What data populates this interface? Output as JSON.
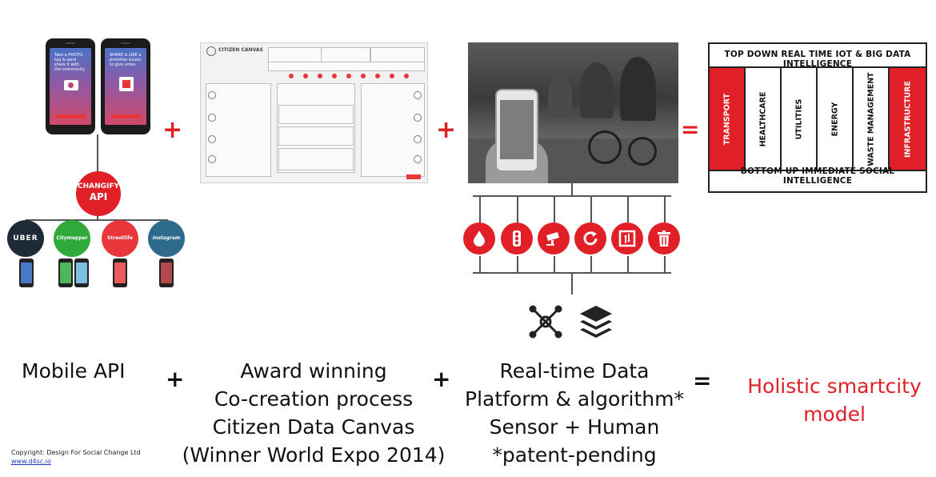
{
  "phones": {
    "left_text": "Take a PHOTO, tag & send share it with the community",
    "right_text": "SHARE & LIKE a prioritise issues to give votes"
  },
  "api": {
    "label_line1": "CHANGIFY",
    "label_line2": "API"
  },
  "brands": [
    "UBER",
    "Citymapper",
    "Streetlife",
    "Instagram"
  ],
  "canvas": {
    "title": "CITIZEN CANVAS"
  },
  "matrix": {
    "top": "TOP DOWN REAL TIME IOT & BIG DATA INTELLIGENCE",
    "bottom": "BOTTOM UP IMMEDIATE SOCIAL INTELLIGENCE",
    "columns": [
      "TRANSPORT",
      "HEALTHCARE",
      "UTILITIES",
      "ENERGY",
      "WASTE MANAGEMENT",
      "INFRASTRUCTURE"
    ]
  },
  "captions": {
    "mobile": "Mobile API",
    "cocreation": [
      "Award winning",
      "Co-creation process",
      "Citizen Data Canvas",
      "(Winner World Expo 2014)"
    ],
    "platform": [
      "Real-time Data",
      "Platform & algorithm*",
      "Sensor + Human",
      "*patent-pending"
    ],
    "result": [
      "Holistic  smartcity",
      "model"
    ],
    "plus": "+",
    "equals": "="
  },
  "copyright": {
    "line1": "Copyright: Design For Social Change Ltd",
    "link": "www.d4sc.io"
  },
  "colors": {
    "accent": "#e01f26",
    "matrix_red_columns": [
      "TRANSPORT",
      "INFRASTRUCTURE"
    ]
  },
  "icons": {
    "sensors": [
      "water-drop-icon",
      "traffic-light-icon",
      "cctv-camera-icon",
      "refresh-icon",
      "elevator-icon",
      "trash-icon"
    ],
    "platform": [
      "network-icon",
      "layers-icon"
    ]
  }
}
